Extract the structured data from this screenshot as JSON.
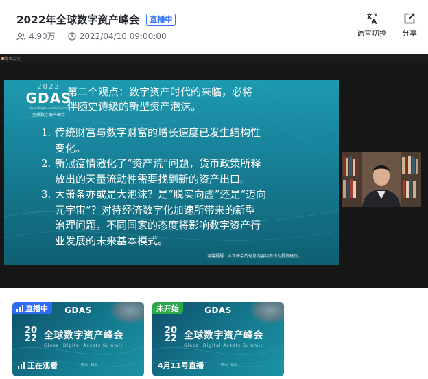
{
  "header": {
    "title": "2022年全球数字资产峰会",
    "live_badge": "直播中",
    "viewers": "4.90万",
    "datetime": "2022/04/10 09:00:00",
    "actions": [
      {
        "label": "语言切换",
        "icon": "translate-icon"
      },
      {
        "label": "分享",
        "icon": "share-icon"
      }
    ]
  },
  "video": {
    "topbar_text": "腾讯会议",
    "slide": {
      "logo_year": "2022",
      "logo_name": "GDAS",
      "logo_sub": "Global Digital Assets Summit",
      "logo_cn": "全球数字资产峰会",
      "heading_line1": "第二个观点：数字资产时代的来临，必将",
      "heading_line2": "伴随史诗级的新型资产泡沫。",
      "points": [
        {
          "num": "1.",
          "lines": [
            "传统财富与数字财富的增长速度已发生结构性",
            "变化。"
          ]
        },
        {
          "num": "2.",
          "lines": [
            "新冠疫情激化了“资产荒”问题，货币政策所释",
            "放出的天量流动性需要找到新的资产出口。"
          ]
        },
        {
          "num": "3.",
          "lines": [
            "大萧条亦或是大泡沫？是“脱实向虚”还是“迈向",
            "元宇宙”？对待经济数字化加速所带来的新型",
            "治理问题，不同国家的态度将影响数字资产行",
            "业发展的未来基本模式。"
          ]
        }
      ],
      "note": "温馨提醒：本次峰会的讨论内容均不作为投资建议。"
    }
  },
  "thumbnails": [
    {
      "tag": "直播中",
      "tag_status": "live",
      "brand": "GDAS",
      "year_top": "20",
      "year_bottom": "22",
      "title": "全球数字资产峰会",
      "summit": "Global Digital Assets Summit",
      "footer": "正在观看",
      "footer_faint": "腾讯 · 峰会"
    },
    {
      "tag": "未开始",
      "tag_status": "upcoming",
      "brand": "GDAS",
      "year_top": "20",
      "year_bottom": "22",
      "title": "全球数字资产峰会",
      "summit": "Global Digital Assets Summit",
      "footer": "4月11号直播",
      "footer_faint": "腾讯 · 峰会"
    }
  ],
  "colors": {
    "accent_blue": "#3370ff",
    "live_tag": "#2f6bf0",
    "upcoming_tag": "#2aa84a",
    "slide_teal": "#1d9ab0"
  }
}
